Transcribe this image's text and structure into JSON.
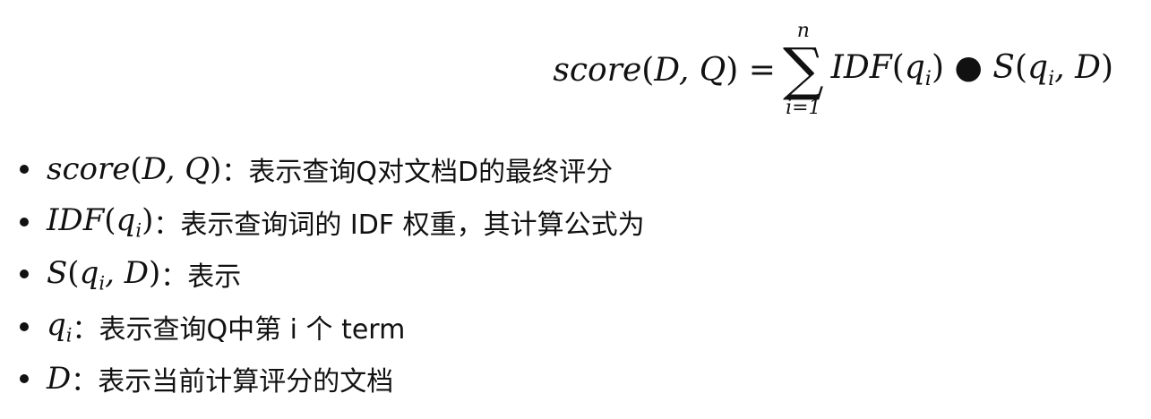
{
  "formula": {
    "lhs": "score(D,Q) =",
    "sum_upper": "n",
    "sum_lower": "i=1",
    "rhs": "IDF(qi) • S(qi,D)"
  },
  "bullets": [
    {
      "term": "score(D,Q)",
      "description": "：表示查询Q对文档D的最终评分"
    },
    {
      "term": "IDF(qi)",
      "description": "：表示查询词的 IDF 权重，其计算公式为"
    },
    {
      "term": "S(qi,D)",
      "description": "：表示"
    },
    {
      "term": "qi",
      "description": "：表示查询Q中第 i 个 term"
    },
    {
      "term": "D",
      "description": "：表示当前计算评分的文档"
    }
  ]
}
